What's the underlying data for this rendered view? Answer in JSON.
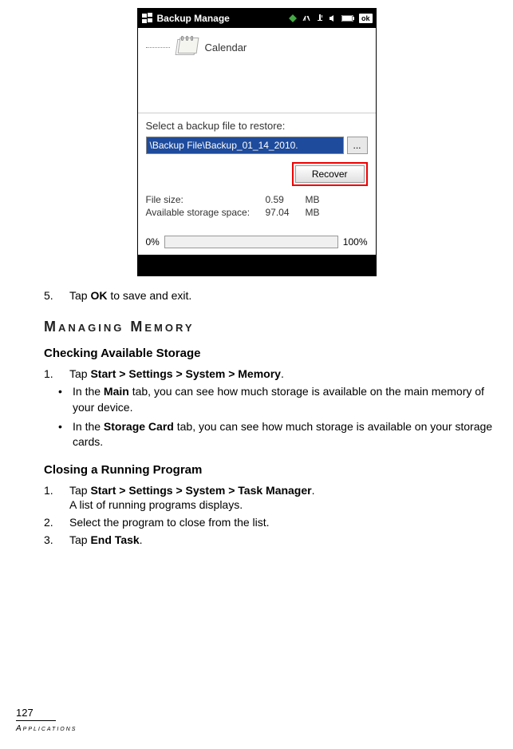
{
  "screenshot": {
    "titlebar": {
      "title": "Backup Manage",
      "ok": "ok"
    },
    "calendar_label": "Calendar",
    "restore": {
      "prompt": "Select a backup file to restore:",
      "path": "\\Backup File\\Backup_01_14_2010.",
      "browse": "...",
      "recover": "Recover"
    },
    "stats": {
      "filesize_label": "File size:",
      "filesize_value": "0.59",
      "filesize_unit": "MB",
      "storage_label": "Available storage space:",
      "storage_value": "97.04",
      "storage_unit": "MB"
    },
    "progress": {
      "start": "0%",
      "end": "100%"
    }
  },
  "doc": {
    "step5_num": "5.",
    "step5_text_pre": "Tap ",
    "step5_text_bold": "OK",
    "step5_text_post": " to save and exit.",
    "heading_managing": "Managing Memory",
    "subheading_checking": "Checking Available Storage",
    "check_step1_num": "1.",
    "check_step1_pre": "Tap ",
    "check_step1_bold": "Start > Settings > System > Memory",
    "check_step1_post": ".",
    "bullet1_pre": "In the ",
    "bullet1_bold": "Main",
    "bullet1_post": " tab, you can see how much storage is available on the main memory of your device.",
    "bullet2_pre": "In the ",
    "bullet2_bold": "Storage Card",
    "bullet2_post": " tab, you can see how much storage is available on your storage cards.",
    "subheading_closing": "Closing a Running Program",
    "close_step1_num": "1.",
    "close_step1_pre": "Tap ",
    "close_step1_bold": "Start > Settings > System > Task Manager",
    "close_step1_post": ".",
    "close_step1_sub": "A list of running programs displays.",
    "close_step2_num": "2.",
    "close_step2_text": "Select the program to close from the list.",
    "close_step3_num": "3.",
    "close_step3_pre": "Tap ",
    "close_step3_bold": "End Task",
    "close_step3_post": ".",
    "bullet_char": "•"
  },
  "footer": {
    "page": "127",
    "label": "Applications"
  }
}
